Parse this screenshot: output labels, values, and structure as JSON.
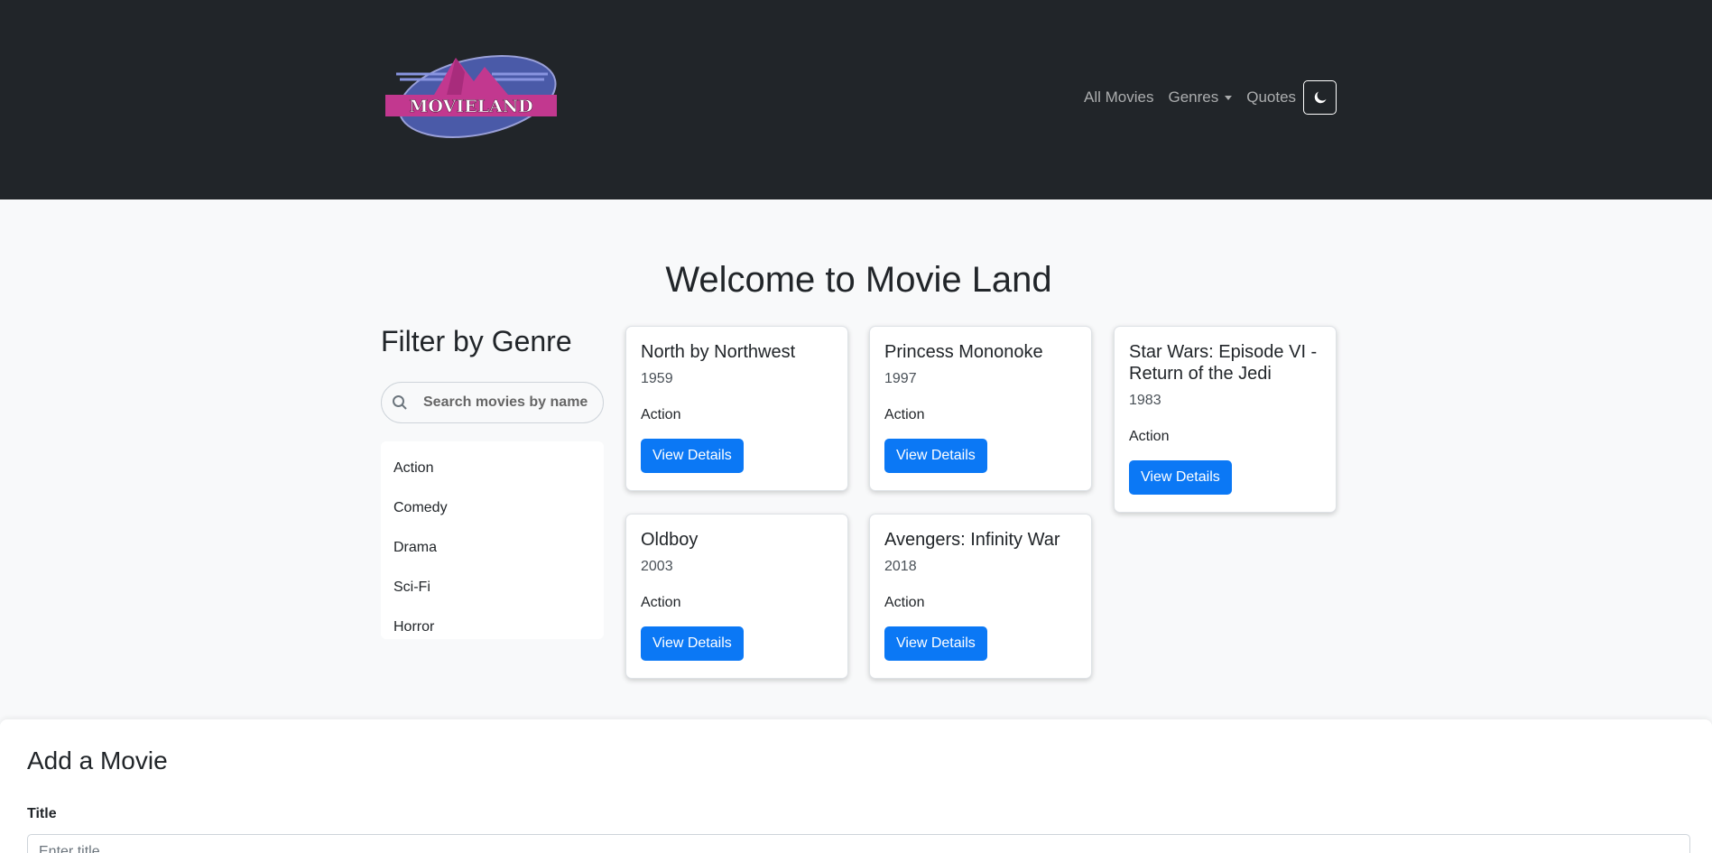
{
  "brand": {
    "logo_text": "MOVIELAND"
  },
  "nav": {
    "all_movies": "All Movies",
    "genres": "Genres",
    "quotes": "Quotes",
    "theme_toggle_icon": "moon-icon"
  },
  "main": {
    "welcome": "Welcome to Movie Land",
    "filter_title": "Filter by Genre",
    "search_placeholder": "Search movies by name",
    "genres": [
      "Action",
      "Comedy",
      "Drama",
      "Sci-Fi",
      "Horror"
    ]
  },
  "movies": [
    {
      "title": "North by Northwest",
      "year": "1959",
      "genre": "Action",
      "button": "View Details"
    },
    {
      "title": "Princess Mononoke",
      "year": "1997",
      "genre": "Action",
      "button": "View Details"
    },
    {
      "title": "Star Wars: Episode VI - Return of the Jedi",
      "year": "1983",
      "genre": "Action",
      "button": "View Details"
    },
    {
      "title": "Oldboy",
      "year": "2003",
      "genre": "Action",
      "button": "View Details"
    },
    {
      "title": "Avengers: Infinity War",
      "year": "2018",
      "genre": "Action",
      "button": "View Details"
    }
  ],
  "add_movie": {
    "heading": "Add a Movie",
    "title_label": "Title",
    "title_placeholder": "Enter title"
  },
  "colors": {
    "navbar": "#212529",
    "primary": "#0b78f5",
    "logo_pink": "#c2388f",
    "logo_blue": "#4a5aa8"
  }
}
